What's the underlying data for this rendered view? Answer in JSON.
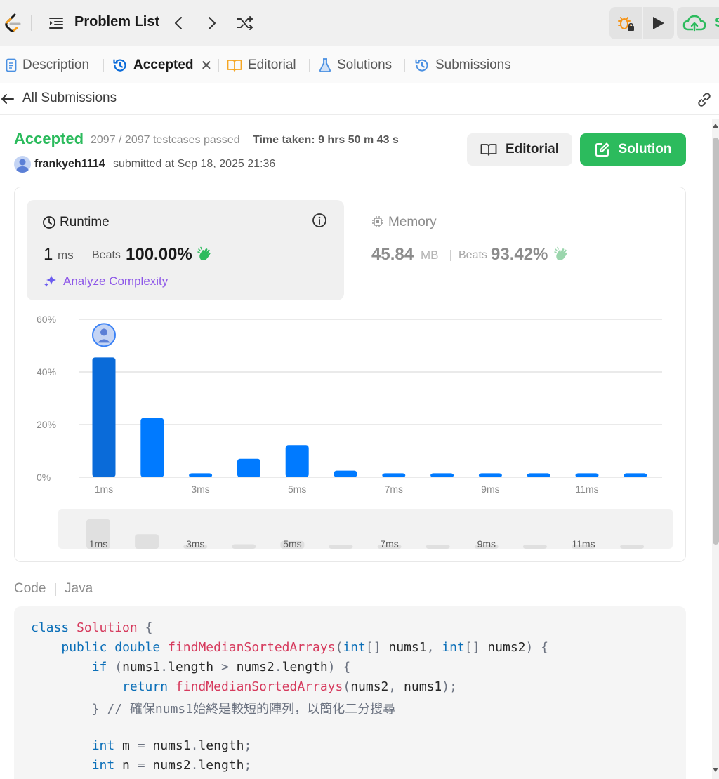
{
  "topbar": {
    "problem_list": "Problem List"
  },
  "tabs": [
    {
      "label": "Description"
    },
    {
      "label": "Accepted"
    },
    {
      "label": "Editorial"
    },
    {
      "label": "Solutions"
    },
    {
      "label": "Submissions"
    }
  ],
  "back": {
    "label": "All Submissions"
  },
  "result": {
    "status": "Accepted",
    "testcases": "2097 / 2097 testcases passed",
    "time_taken": "Time taken: 9 hrs 50 m 43 s",
    "username": "frankyeh1114",
    "submitted_at": "submitted at Sep 18, 2025 21:36",
    "editorial_label": "Editorial",
    "solution_label": "Solution"
  },
  "runtime": {
    "title": "Runtime",
    "value": "1",
    "unit": "ms",
    "beats_label": "Beats",
    "beats": "100.00%",
    "analyze": "Analyze Complexity"
  },
  "memory": {
    "title": "Memory",
    "value": "45.84",
    "unit": "MB",
    "beats_label": "Beats",
    "beats": "93.42%"
  },
  "colors": {
    "accent_green": "#2cbb5d",
    "bar_blue": "#007aff",
    "bar_selected": "#0a6bd9",
    "purple": "#8c55e8"
  },
  "chart_data": {
    "type": "bar",
    "categories": [
      "1ms",
      "2ms",
      "3ms",
      "4ms",
      "5ms",
      "6ms",
      "7ms",
      "8ms",
      "9ms",
      "10ms",
      "11ms",
      "12ms"
    ],
    "x_tick_labels": [
      "1ms",
      "3ms",
      "5ms",
      "7ms",
      "9ms",
      "11ms"
    ],
    "values": [
      45.5,
      22.5,
      1.5,
      7,
      12.2,
      2.5,
      1.5,
      1.5,
      1.5,
      1.5,
      1.5,
      1.5
    ],
    "y_tick_labels": [
      "0%",
      "20%",
      "40%",
      "60%"
    ],
    "ylim": [
      0,
      60
    ],
    "highlighted_category": "1ms",
    "grid": true,
    "minimap_tick_labels": [
      "1ms",
      "3ms",
      "5ms",
      "7ms",
      "9ms",
      "11ms"
    ]
  },
  "code": {
    "tab": "Code",
    "lang": "Java",
    "lines": [
      "class Solution {",
      "    public double findMedianSortedArrays(int[] nums1, int[] nums2) {",
      "        if (nums1.length > nums2.length) {",
      "            return findMedianSortedArrays(nums2, nums1);",
      "        } // 確保nums1始終是較短的陣列，以簡化二分搜尋",
      "",
      "        int m = nums1.length;",
      "        int n = nums2.length;"
    ]
  }
}
